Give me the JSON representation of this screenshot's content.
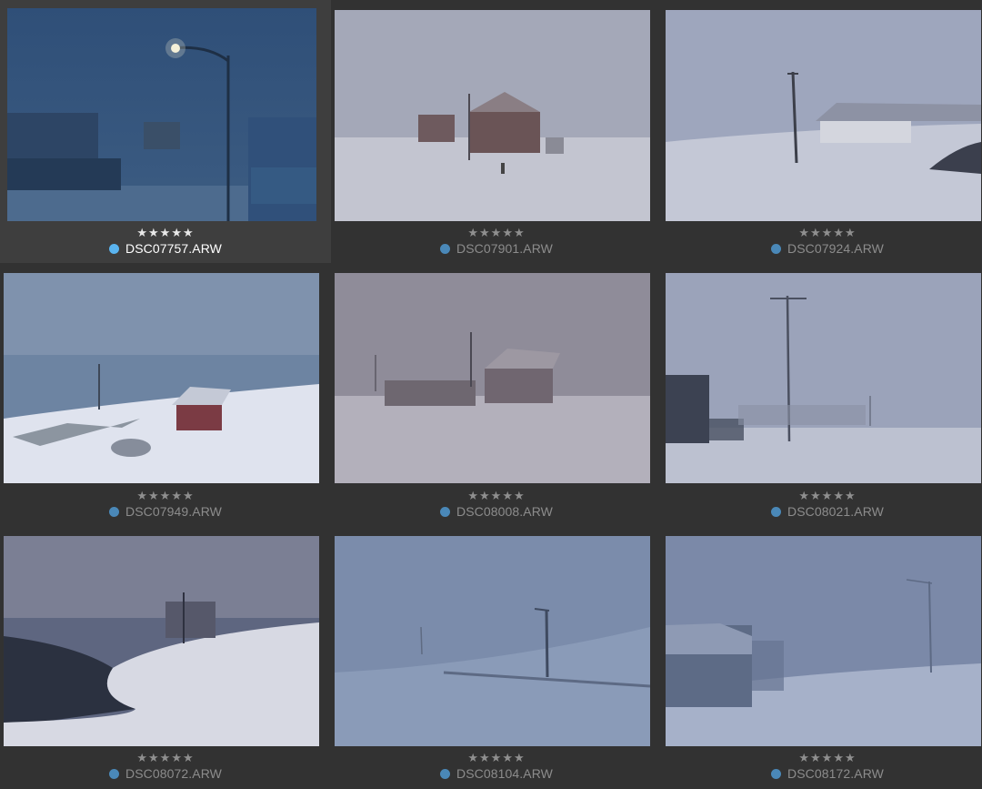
{
  "grid": {
    "photos": [
      {
        "filename": "DSC07757.ARW",
        "rating": 5,
        "selected": true,
        "color_label": "#5ab4f0"
      },
      {
        "filename": "DSC07901.ARW",
        "rating": 5,
        "selected": false,
        "color_label": "#4a88b8"
      },
      {
        "filename": "DSC07924.ARW",
        "rating": 5,
        "selected": false,
        "color_label": "#4a88b8"
      },
      {
        "filename": "DSC07949.ARW",
        "rating": 5,
        "selected": false,
        "color_label": "#4a88b8"
      },
      {
        "filename": "DSC08008.ARW",
        "rating": 5,
        "selected": false,
        "color_label": "#4a88b8"
      },
      {
        "filename": "DSC08021.ARW",
        "rating": 5,
        "selected": false,
        "color_label": "#4a88b8"
      },
      {
        "filename": "DSC08072.ARW",
        "rating": 5,
        "selected": false,
        "color_label": "#4a88b8"
      },
      {
        "filename": "DSC08104.ARW",
        "rating": 5,
        "selected": false,
        "color_label": "#4a88b8"
      },
      {
        "filename": "DSC08172.ARW",
        "rating": 5,
        "selected": false,
        "color_label": "#4a88b8"
      }
    ],
    "star_glyph": "★"
  },
  "colors": {
    "background": "#323232",
    "selected_cell": "#3e3e3e",
    "selected_text": "#ffffff",
    "text": "#8c8c8c"
  }
}
